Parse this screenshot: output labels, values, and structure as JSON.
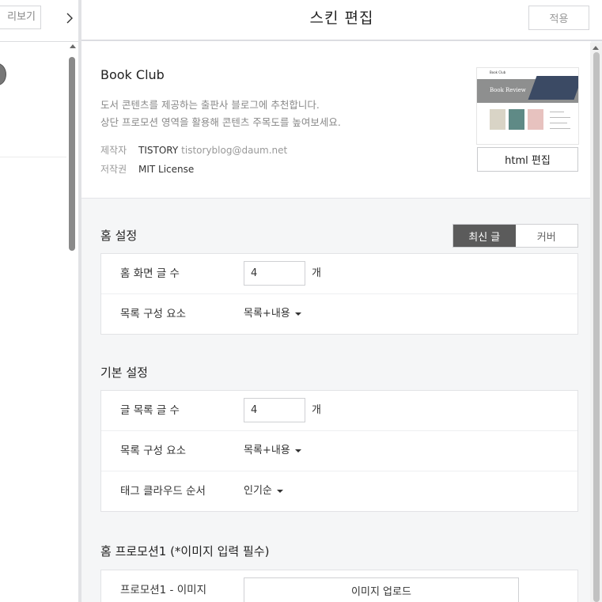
{
  "left": {
    "preview_label": "리보기",
    "collapse_icon": "chevron-right-icon"
  },
  "header": {
    "title": "스킨 편집",
    "apply_label": "적용"
  },
  "skin": {
    "name": "Book Club",
    "desc_line1": "도서 콘텐츠를 제공하는 출판사 블로그에 추천합니다.",
    "desc_line2": "상단 프로모션 영역을 활용해 콘텐츠 주목도를 높여보세요.",
    "author_label": "제작자",
    "author_name": "TISTORY",
    "author_email": "tistoryblog@daum.net",
    "license_label": "저작권",
    "license_value": "MIT License",
    "thumbnail_brand": "Book Club",
    "thumbnail_title": "Book Review",
    "html_edit_label": "html 편집"
  },
  "home_settings": {
    "title": "홈 설정",
    "tabs": [
      {
        "label": "최신 글",
        "active": true
      },
      {
        "label": "커버",
        "active": false
      }
    ],
    "post_count_label": "홈 화면 글 수",
    "post_count_value": "4",
    "post_count_unit": "개",
    "list_element_label": "목록 구성 요소",
    "list_element_value": "목록+내용"
  },
  "basic_settings": {
    "title": "기본 설정",
    "post_count_label": "글 목록 글 수",
    "post_count_value": "4",
    "post_count_unit": "개",
    "list_element_label": "목록 구성 요소",
    "list_element_value": "목록+내용",
    "tag_order_label": "태그 클라우드 순서",
    "tag_order_value": "인기순"
  },
  "promotion1": {
    "title": "홈 프로모션1 (*이미지 입력 필수)",
    "image_label": "프로모션1 - 이미지",
    "upload_label": "이미지 업로드"
  },
  "colors": {
    "active_tab_bg": "#5b5b5b",
    "panel_bg": "#f5f6f7",
    "border": "#e2e3e6"
  }
}
